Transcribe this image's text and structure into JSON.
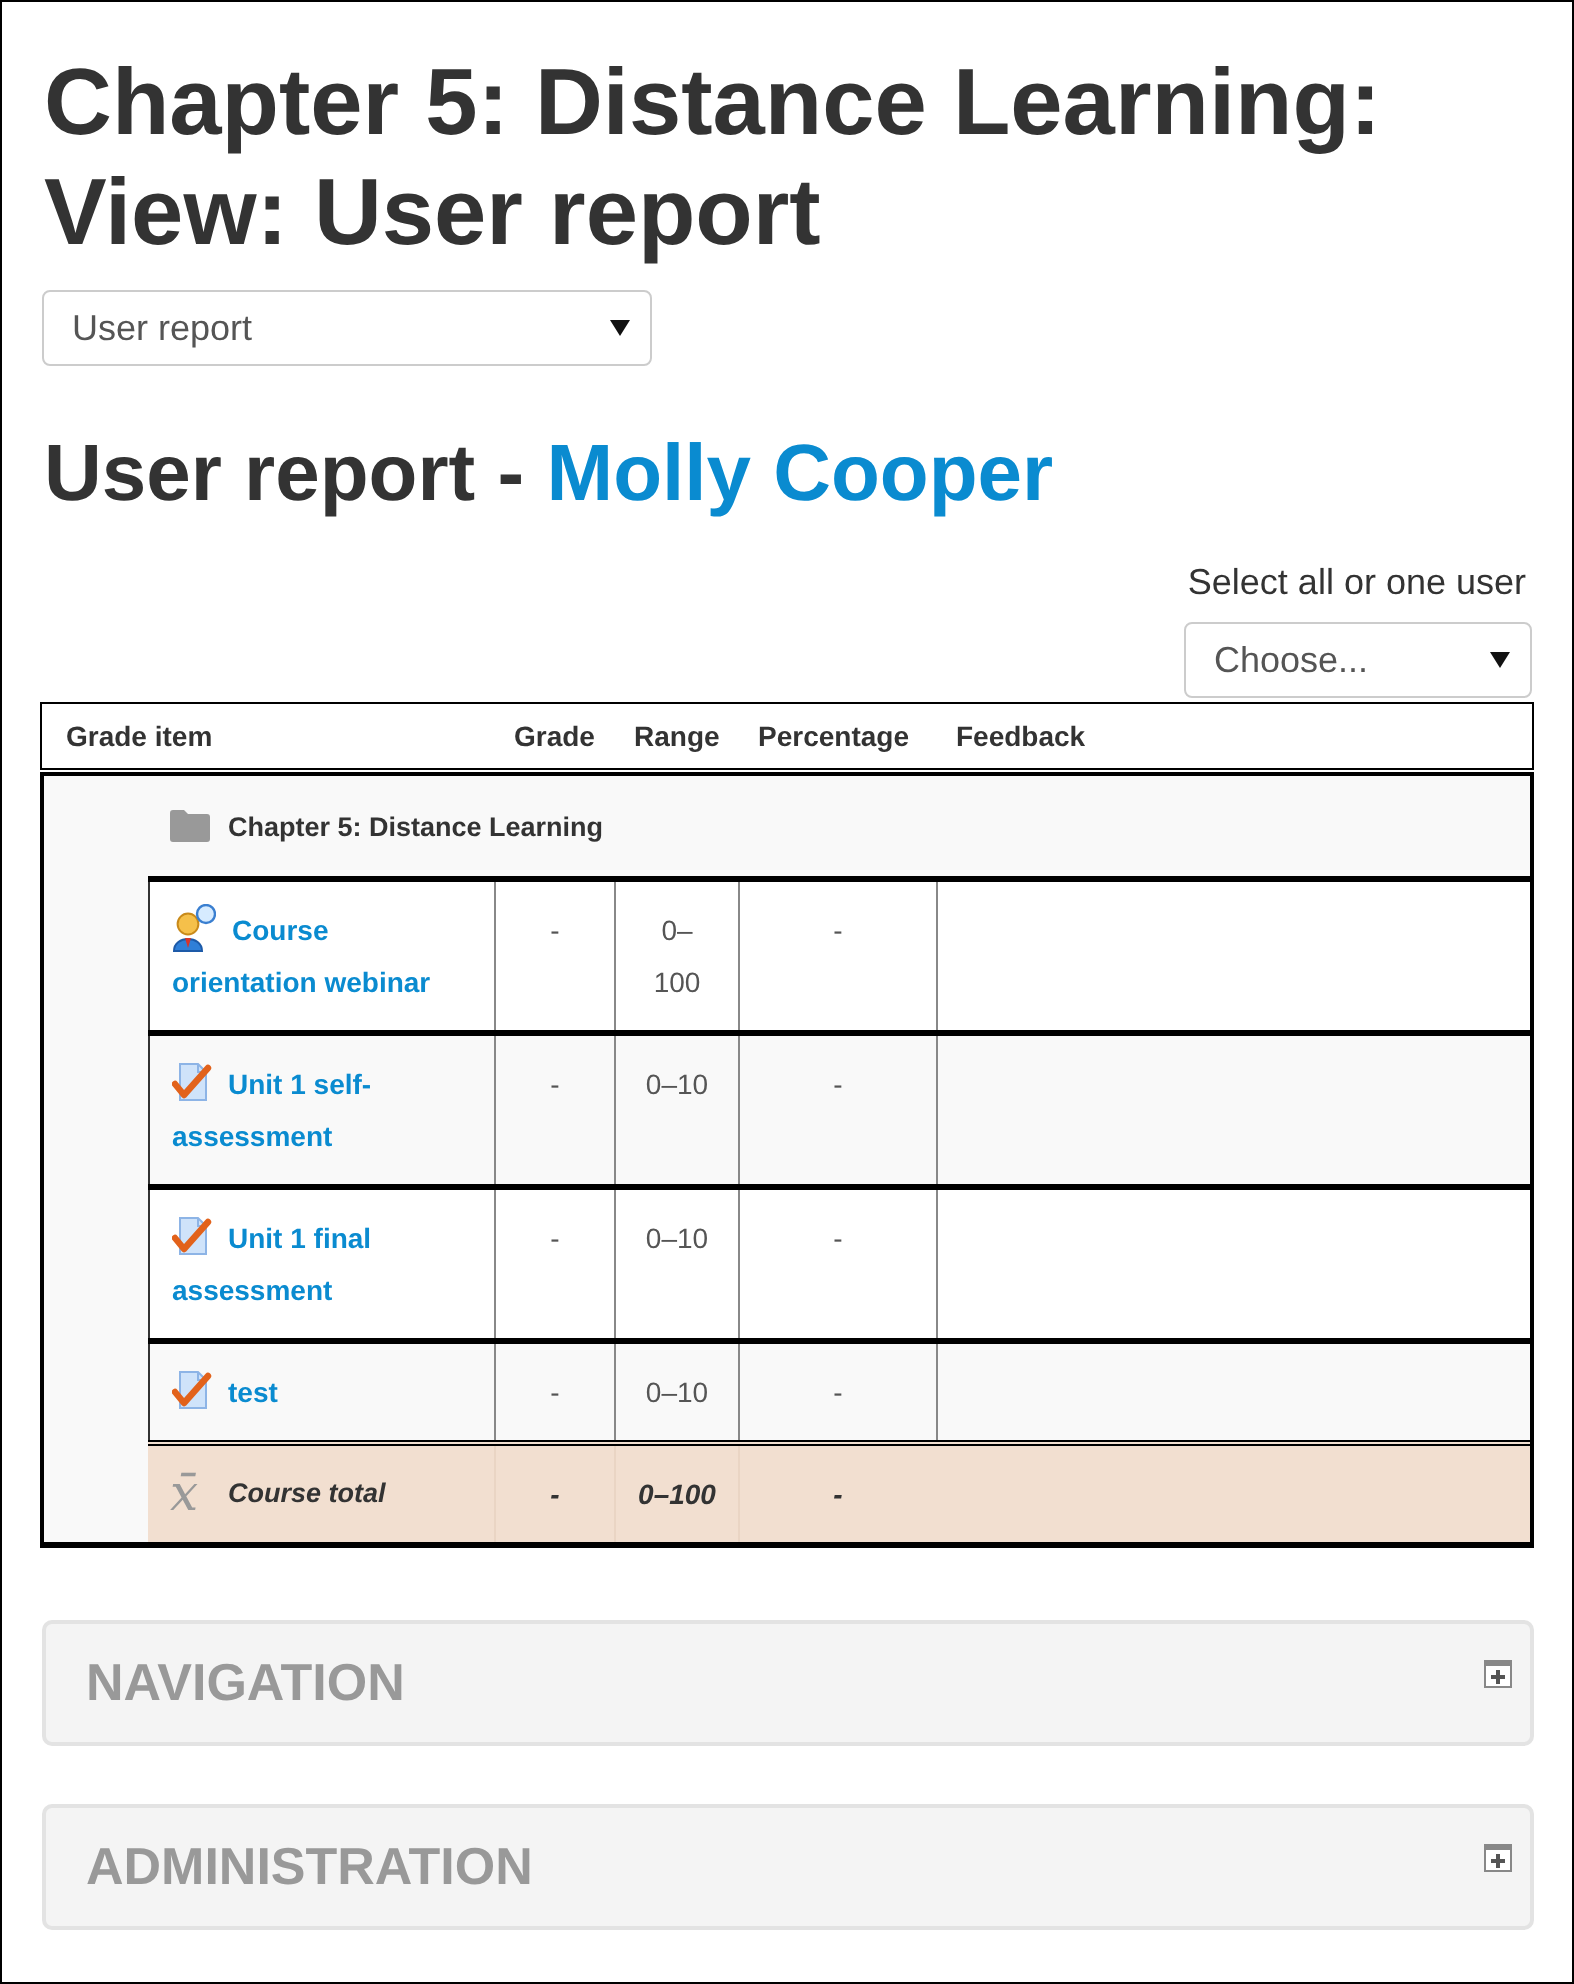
{
  "page_title": "Chapter 5: Distance Learning: View: User report",
  "report_select": {
    "value": "User report"
  },
  "report_heading": {
    "text": "User report -",
    "user_link": "Molly Cooper"
  },
  "user_select": {
    "label": "Select all or one user",
    "value": "Choose..."
  },
  "grade_table": {
    "columns": [
      "Grade item",
      "Grade",
      "Range",
      "Percentage",
      "Feedback"
    ],
    "category": {
      "name": "Chapter 5: Distance Learning"
    },
    "rows": [
      {
        "kind": "webinar",
        "item": "Course orientation webinar",
        "grade": "-",
        "range": "0–100",
        "percentage": "-"
      },
      {
        "kind": "quiz",
        "item": "Unit 1 self-assessment",
        "grade": "-",
        "range": "0–10",
        "percentage": "-"
      },
      {
        "kind": "quiz",
        "item": "Unit 1 final assessment",
        "grade": "-",
        "range": "0–10",
        "percentage": "-"
      },
      {
        "kind": "quiz",
        "item": "test",
        "grade": "-",
        "range": "0–10",
        "percentage": "-"
      }
    ],
    "total": {
      "symbol": "x̄",
      "label": "Course total",
      "grade": "-",
      "range": "0–100",
      "percentage": "-"
    }
  },
  "blocks": [
    {
      "title": "NAVIGATION",
      "expanded": false
    },
    {
      "title": "ADMINISTRATION",
      "expanded": false
    }
  ]
}
